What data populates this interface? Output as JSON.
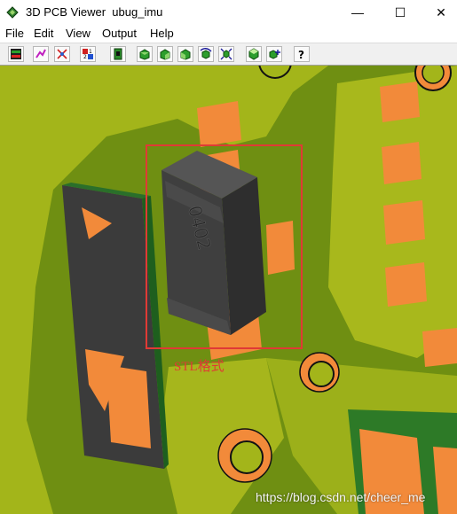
{
  "window": {
    "title": "3D PCB Viewer  ubug_imu",
    "minimize_label": "—",
    "maximize_label": "☐",
    "close_label": "✕"
  },
  "menu": [
    "File",
    "Edit",
    "View",
    "Output",
    "Help"
  ],
  "toolbar": {
    "buttons": [
      "layers-icon",
      "route-icon",
      "net-icon",
      "numbers-icon",
      "component-icon",
      "view-front-icon",
      "view-side-icon",
      "view-back-icon",
      "rotate-icon",
      "fit-icon",
      "view-top-icon",
      "move-icon",
      "help-icon"
    ]
  },
  "viewport": {
    "component_marking": "0402",
    "annotation_label": "STL格式",
    "watermark": "https://blog.csdn.net/cheer_me"
  },
  "colors": {
    "pcb_green": "#6f8f12",
    "pad_orange": "#f28a3a",
    "annotation_red": "#e03a35",
    "component_gray": "#3c3c3c"
  }
}
